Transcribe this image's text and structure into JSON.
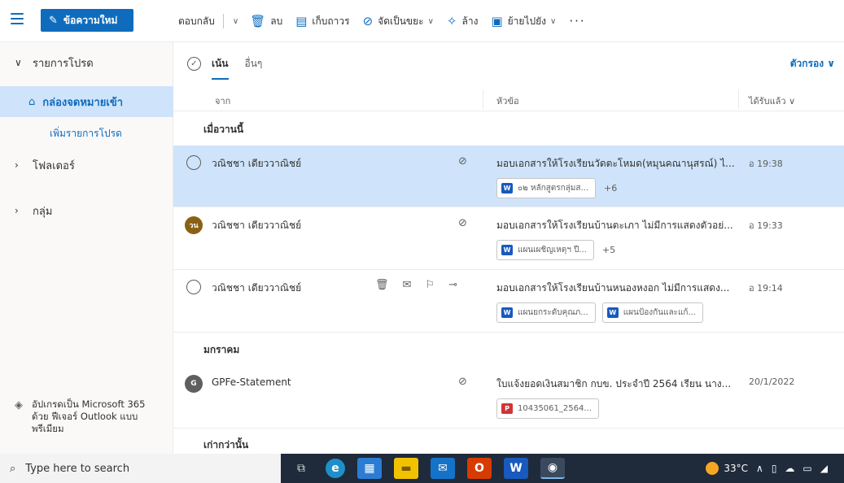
{
  "toolbar": {
    "new_label": "ข้อความใหม่",
    "reply_label": "ตอบกลับ",
    "delete_label": "ลบ",
    "archive_label": "เก็บถาวร",
    "junk_label": "จัดเป็นขยะ",
    "sweep_label": "ล้าง",
    "move_label": "ย้ายไปยัง",
    "more_label": "···"
  },
  "nav": {
    "favorites": "รายการโปรด",
    "inbox": "กล่องจดหมายเข้า",
    "add_favorite": "เพิ่มรายการโปรด",
    "folders": "โฟลเดอร์",
    "groups": "กลุ่ม",
    "upgrade": "อัปเกรดเป็น Microsoft 365 ด้วย ฟีเจอร์ Outlook แบบพรีเมียม"
  },
  "list": {
    "tab_focused": "เน้น",
    "tab_other": "อื่นๆ",
    "filter": "ตัวกรอง ∨",
    "col_from": "จาก",
    "col_subject": "หัวข้อ",
    "col_received": "ได้รับแล้ว ∨",
    "section_yesterday": "เมื่อวานนี้",
    "section_january": "มกราคม",
    "section_older": "เก่ากว่านั้น"
  },
  "emails": [
    {
      "sender": "วณิชชา เดียววาณิชย์",
      "subject": "มอบเอกสารให้โรงเรียนวัดตะโหมด(หมุนคณานุสรณ์)  ไ...",
      "date": "อ 19:38",
      "chip1": "๐๒ หลักสูตรกลุ่มส...",
      "more": "+6"
    },
    {
      "sender": "วณิชชา เดียววาณิชย์",
      "avatar": "วน",
      "subject": "มอบเอกสารให้โรงเรียนบ้านตะเภา   ไม่มีการแสดงตัวอย่...",
      "date": "อ 19:33",
      "chip1": "แผนเผชิญเหตุฯ ปี...",
      "more": "+5"
    },
    {
      "sender": "วณิชชา เดียววาณิชย์",
      "subject": "มอบเอกสารให้โรงเรียนบ้านหนองหงอก   ไม่มีการแสดง...",
      "date": "อ 19:14",
      "chip1": "แผนยกระดับคุณภ...",
      "chip2": "แผนป้องกันและแก้..."
    },
    {
      "sender": "GPFe-Statement",
      "avatar": "G",
      "subject": "ใบแจ้งยอดเงินสมาชิก กบข. ประจำปี 2564   เรียน นาง...",
      "date": "20/1/2022",
      "chip1": "10435061_2564..."
    }
  ],
  "taskbar": {
    "search_placeholder": "Type here to search",
    "temperature": "33°C"
  },
  "colors": {
    "accent": "#0f6cbd",
    "selected_row": "#cfe4fa",
    "avatar_brown": "#8a6114",
    "avatar_gray": "#5f5f5f"
  }
}
